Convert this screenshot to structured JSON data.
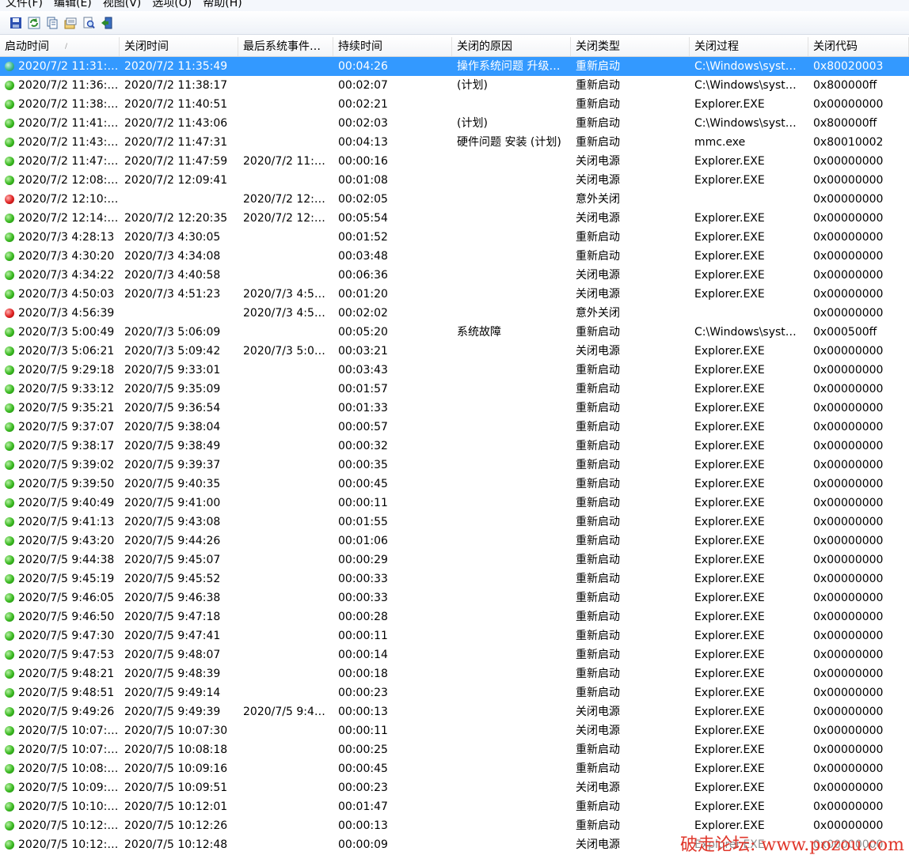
{
  "menu": [
    "文件(F)",
    "编辑(E)",
    "视图(V)",
    "选项(O)",
    "帮助(H)"
  ],
  "toolbar": [
    {
      "icon": "save-icon"
    },
    {
      "icon": "refresh-icon"
    },
    {
      "icon": "copy-icon"
    },
    {
      "icon": "properties-icon"
    },
    {
      "icon": "find-icon"
    },
    {
      "icon": "exit-icon"
    }
  ],
  "columns": [
    "启动时间",
    "关闭时间",
    "最后系统事件…",
    "持续时间",
    "关闭的原因",
    "关闭类型",
    "关闭过程",
    "关闭代码"
  ],
  "sort_indicator": "/",
  "rows": [
    {
      "status": "selected",
      "cells": [
        "2020/7/2 11:31:…",
        "2020/7/2 11:35:49",
        "",
        "00:04:26",
        "操作系统问题 升级…",
        "重新启动",
        "C:\\Windows\\syst…",
        "0x80020003"
      ]
    },
    {
      "status": "green",
      "cells": [
        "2020/7/2 11:36:…",
        "2020/7/2 11:38:17",
        "",
        "00:02:07",
        " (计划)",
        "重新启动",
        "C:\\Windows\\syst…",
        "0x800000ff"
      ]
    },
    {
      "status": "green",
      "cells": [
        "2020/7/2 11:38:…",
        "2020/7/2 11:40:51",
        "",
        "00:02:21",
        "",
        "重新启动",
        "Explorer.EXE",
        "0x00000000"
      ]
    },
    {
      "status": "green",
      "cells": [
        "2020/7/2 11:41:…",
        "2020/7/2 11:43:06",
        "",
        "00:02:03",
        " (计划)",
        "重新启动",
        "C:\\Windows\\syst…",
        "0x800000ff"
      ]
    },
    {
      "status": "green",
      "cells": [
        "2020/7/2 11:43:…",
        "2020/7/2 11:47:31",
        "",
        "00:04:13",
        "硬件问题 安装 (计划)",
        "重新启动",
        "mmc.exe",
        "0x80010002"
      ]
    },
    {
      "status": "green",
      "cells": [
        "2020/7/2 11:47:…",
        "2020/7/2 11:47:59",
        "2020/7/2 11:…",
        "00:00:16",
        "",
        "关闭电源",
        "Explorer.EXE",
        "0x00000000"
      ]
    },
    {
      "status": "green",
      "cells": [
        "2020/7/2 12:08:…",
        "2020/7/2 12:09:41",
        "",
        "00:01:08",
        "",
        "关闭电源",
        "Explorer.EXE",
        "0x00000000"
      ]
    },
    {
      "status": "red",
      "cells": [
        "2020/7/2 12:10:…",
        "",
        "2020/7/2 12:…",
        "00:02:05",
        "",
        "意外关闭",
        "",
        "0x00000000"
      ]
    },
    {
      "status": "green",
      "cells": [
        "2020/7/2 12:14:…",
        "2020/7/2 12:20:35",
        "2020/7/2 12:…",
        "00:05:54",
        "",
        "关闭电源",
        "Explorer.EXE",
        "0x00000000"
      ]
    },
    {
      "status": "green",
      "cells": [
        "2020/7/3 4:28:13",
        "2020/7/3 4:30:05",
        "",
        "00:01:52",
        "",
        "重新启动",
        "Explorer.EXE",
        "0x00000000"
      ]
    },
    {
      "status": "green",
      "cells": [
        "2020/7/3 4:30:20",
        "2020/7/3 4:34:08",
        "",
        "00:03:48",
        "",
        "重新启动",
        "Explorer.EXE",
        "0x00000000"
      ]
    },
    {
      "status": "green",
      "cells": [
        "2020/7/3 4:34:22",
        "2020/7/3 4:40:58",
        "",
        "00:06:36",
        "",
        "关闭电源",
        "Explorer.EXE",
        "0x00000000"
      ]
    },
    {
      "status": "green",
      "cells": [
        "2020/7/3 4:50:03",
        "2020/7/3 4:51:23",
        "2020/7/3 4:5…",
        "00:01:20",
        "",
        "关闭电源",
        "Explorer.EXE",
        "0x00000000"
      ]
    },
    {
      "status": "red",
      "cells": [
        "2020/7/3 4:56:39",
        "",
        "2020/7/3 4:5…",
        "00:02:02",
        "",
        "意外关闭",
        "",
        "0x00000000"
      ]
    },
    {
      "status": "green",
      "cells": [
        "2020/7/3 5:00:49",
        "2020/7/3 5:06:09",
        "",
        "00:05:20",
        "系统故障",
        "重新启动",
        "C:\\Windows\\syst…",
        "0x000500ff"
      ]
    },
    {
      "status": "green",
      "cells": [
        "2020/7/3 5:06:21",
        "2020/7/3 5:09:42",
        "2020/7/3 5:0…",
        "00:03:21",
        "",
        "关闭电源",
        "Explorer.EXE",
        "0x00000000"
      ]
    },
    {
      "status": "green",
      "cells": [
        "2020/7/5 9:29:18",
        "2020/7/5 9:33:01",
        "",
        "00:03:43",
        "",
        "重新启动",
        "Explorer.EXE",
        "0x00000000"
      ]
    },
    {
      "status": "green",
      "cells": [
        "2020/7/5 9:33:12",
        "2020/7/5 9:35:09",
        "",
        "00:01:57",
        "",
        "重新启动",
        "Explorer.EXE",
        "0x00000000"
      ]
    },
    {
      "status": "green",
      "cells": [
        "2020/7/5 9:35:21",
        "2020/7/5 9:36:54",
        "",
        "00:01:33",
        "",
        "重新启动",
        "Explorer.EXE",
        "0x00000000"
      ]
    },
    {
      "status": "green",
      "cells": [
        "2020/7/5 9:37:07",
        "2020/7/5 9:38:04",
        "",
        "00:00:57",
        "",
        "重新启动",
        "Explorer.EXE",
        "0x00000000"
      ]
    },
    {
      "status": "green",
      "cells": [
        "2020/7/5 9:38:17",
        "2020/7/5 9:38:49",
        "",
        "00:00:32",
        "",
        "重新启动",
        "Explorer.EXE",
        "0x00000000"
      ]
    },
    {
      "status": "green",
      "cells": [
        "2020/7/5 9:39:02",
        "2020/7/5 9:39:37",
        "",
        "00:00:35",
        "",
        "重新启动",
        "Explorer.EXE",
        "0x00000000"
      ]
    },
    {
      "status": "green",
      "cells": [
        "2020/7/5 9:39:50",
        "2020/7/5 9:40:35",
        "",
        "00:00:45",
        "",
        "重新启动",
        "Explorer.EXE",
        "0x00000000"
      ]
    },
    {
      "status": "green",
      "cells": [
        "2020/7/5 9:40:49",
        "2020/7/5 9:41:00",
        "",
        "00:00:11",
        "",
        "重新启动",
        "Explorer.EXE",
        "0x00000000"
      ]
    },
    {
      "status": "green",
      "cells": [
        "2020/7/5 9:41:13",
        "2020/7/5 9:43:08",
        "",
        "00:01:55",
        "",
        "重新启动",
        "Explorer.EXE",
        "0x00000000"
      ]
    },
    {
      "status": "green",
      "cells": [
        "2020/7/5 9:43:20",
        "2020/7/5 9:44:26",
        "",
        "00:01:06",
        "",
        "重新启动",
        "Explorer.EXE",
        "0x00000000"
      ]
    },
    {
      "status": "green",
      "cells": [
        "2020/7/5 9:44:38",
        "2020/7/5 9:45:07",
        "",
        "00:00:29",
        "",
        "重新启动",
        "Explorer.EXE",
        "0x00000000"
      ]
    },
    {
      "status": "green",
      "cells": [
        "2020/7/5 9:45:19",
        "2020/7/5 9:45:52",
        "",
        "00:00:33",
        "",
        "重新启动",
        "Explorer.EXE",
        "0x00000000"
      ]
    },
    {
      "status": "green",
      "cells": [
        "2020/7/5 9:46:05",
        "2020/7/5 9:46:38",
        "",
        "00:00:33",
        "",
        "重新启动",
        "Explorer.EXE",
        "0x00000000"
      ]
    },
    {
      "status": "green",
      "cells": [
        "2020/7/5 9:46:50",
        "2020/7/5 9:47:18",
        "",
        "00:00:28",
        "",
        "重新启动",
        "Explorer.EXE",
        "0x00000000"
      ]
    },
    {
      "status": "green",
      "cells": [
        "2020/7/5 9:47:30",
        "2020/7/5 9:47:41",
        "",
        "00:00:11",
        "",
        "重新启动",
        "Explorer.EXE",
        "0x00000000"
      ]
    },
    {
      "status": "green",
      "cells": [
        "2020/7/5 9:47:53",
        "2020/7/5 9:48:07",
        "",
        "00:00:14",
        "",
        "重新启动",
        "Explorer.EXE",
        "0x00000000"
      ]
    },
    {
      "status": "green",
      "cells": [
        "2020/7/5 9:48:21",
        "2020/7/5 9:48:39",
        "",
        "00:00:18",
        "",
        "重新启动",
        "Explorer.EXE",
        "0x00000000"
      ]
    },
    {
      "status": "green",
      "cells": [
        "2020/7/5 9:48:51",
        "2020/7/5 9:49:14",
        "",
        "00:00:23",
        "",
        "重新启动",
        "Explorer.EXE",
        "0x00000000"
      ]
    },
    {
      "status": "green",
      "cells": [
        "2020/7/5 9:49:26",
        "2020/7/5 9:49:39",
        "2020/7/5 9:4…",
        "00:00:13",
        "",
        "关闭电源",
        "Explorer.EXE",
        "0x00000000"
      ]
    },
    {
      "status": "green",
      "cells": [
        "2020/7/5 10:07:…",
        "2020/7/5 10:07:30",
        "",
        "00:00:11",
        "",
        "关闭电源",
        "Explorer.EXE",
        "0x00000000"
      ]
    },
    {
      "status": "green",
      "cells": [
        "2020/7/5 10:07:…",
        "2020/7/5 10:08:18",
        "",
        "00:00:25",
        "",
        "重新启动",
        "Explorer.EXE",
        "0x00000000"
      ]
    },
    {
      "status": "green",
      "cells": [
        "2020/7/5 10:08:…",
        "2020/7/5 10:09:16",
        "",
        "00:00:45",
        "",
        "重新启动",
        "Explorer.EXE",
        "0x00000000"
      ]
    },
    {
      "status": "green",
      "cells": [
        "2020/7/5 10:09:…",
        "2020/7/5 10:09:51",
        "",
        "00:00:23",
        "",
        "关闭电源",
        "Explorer.EXE",
        "0x00000000"
      ]
    },
    {
      "status": "green",
      "cells": [
        "2020/7/5 10:10:…",
        "2020/7/5 10:12:01",
        "",
        "00:01:47",
        "",
        "重新启动",
        "Explorer.EXE",
        "0x00000000"
      ]
    },
    {
      "status": "green",
      "cells": [
        "2020/7/5 10:12:…",
        "2020/7/5 10:12:26",
        "",
        "00:00:13",
        "",
        "重新启动",
        "Explorer.EXE",
        "0x00000000"
      ]
    },
    {
      "status": "green",
      "cells": [
        "2020/7/5 10:12:…",
        "2020/7/5 10:12:48",
        "",
        "00:00:09",
        "",
        "关闭电源",
        "Explorer.EXE",
        "0x00000000"
      ]
    }
  ],
  "watermark": "破走论坛: www.pozou.com",
  "colors": {
    "selection": "#3399ff",
    "status_ok": "#39b91f",
    "status_error": "#e02020",
    "watermark": "#e0362a"
  }
}
